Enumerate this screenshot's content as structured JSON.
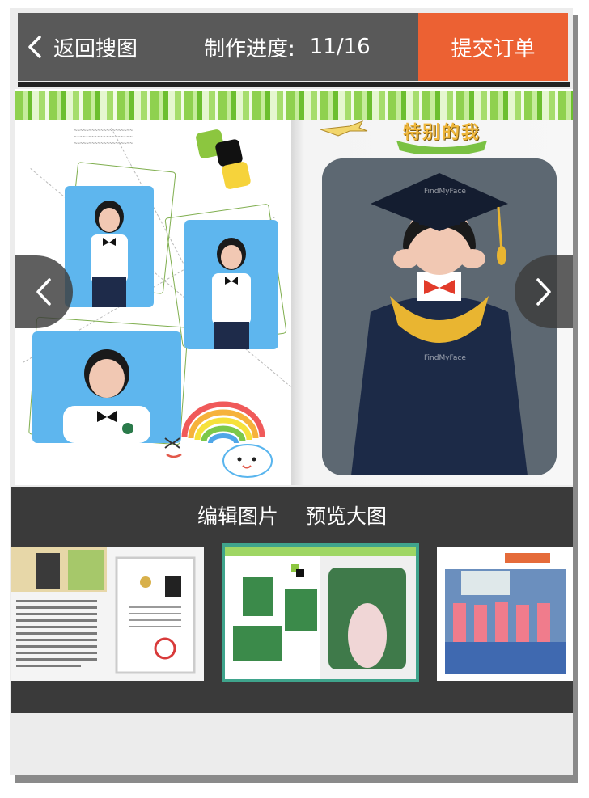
{
  "header": {
    "back_label": "返回搜图",
    "progress_label": "制作进度:",
    "progress_count": "11/16",
    "submit_label": "提交订单"
  },
  "page": {
    "title_art": "特别的我",
    "watermark": "FindMyFace"
  },
  "panel": {
    "edit_label": "编辑图片",
    "preview_label": "预览大图"
  },
  "colors": {
    "topbar": "#595959",
    "submit": "#ec6133",
    "panel": "#3a3a3a",
    "selected_border": "#3fa48c",
    "stripe_green": "#8fd14f"
  },
  "icons": {
    "back": "chevron-left-icon",
    "prev": "chevron-left-icon",
    "next": "chevron-right-icon"
  }
}
